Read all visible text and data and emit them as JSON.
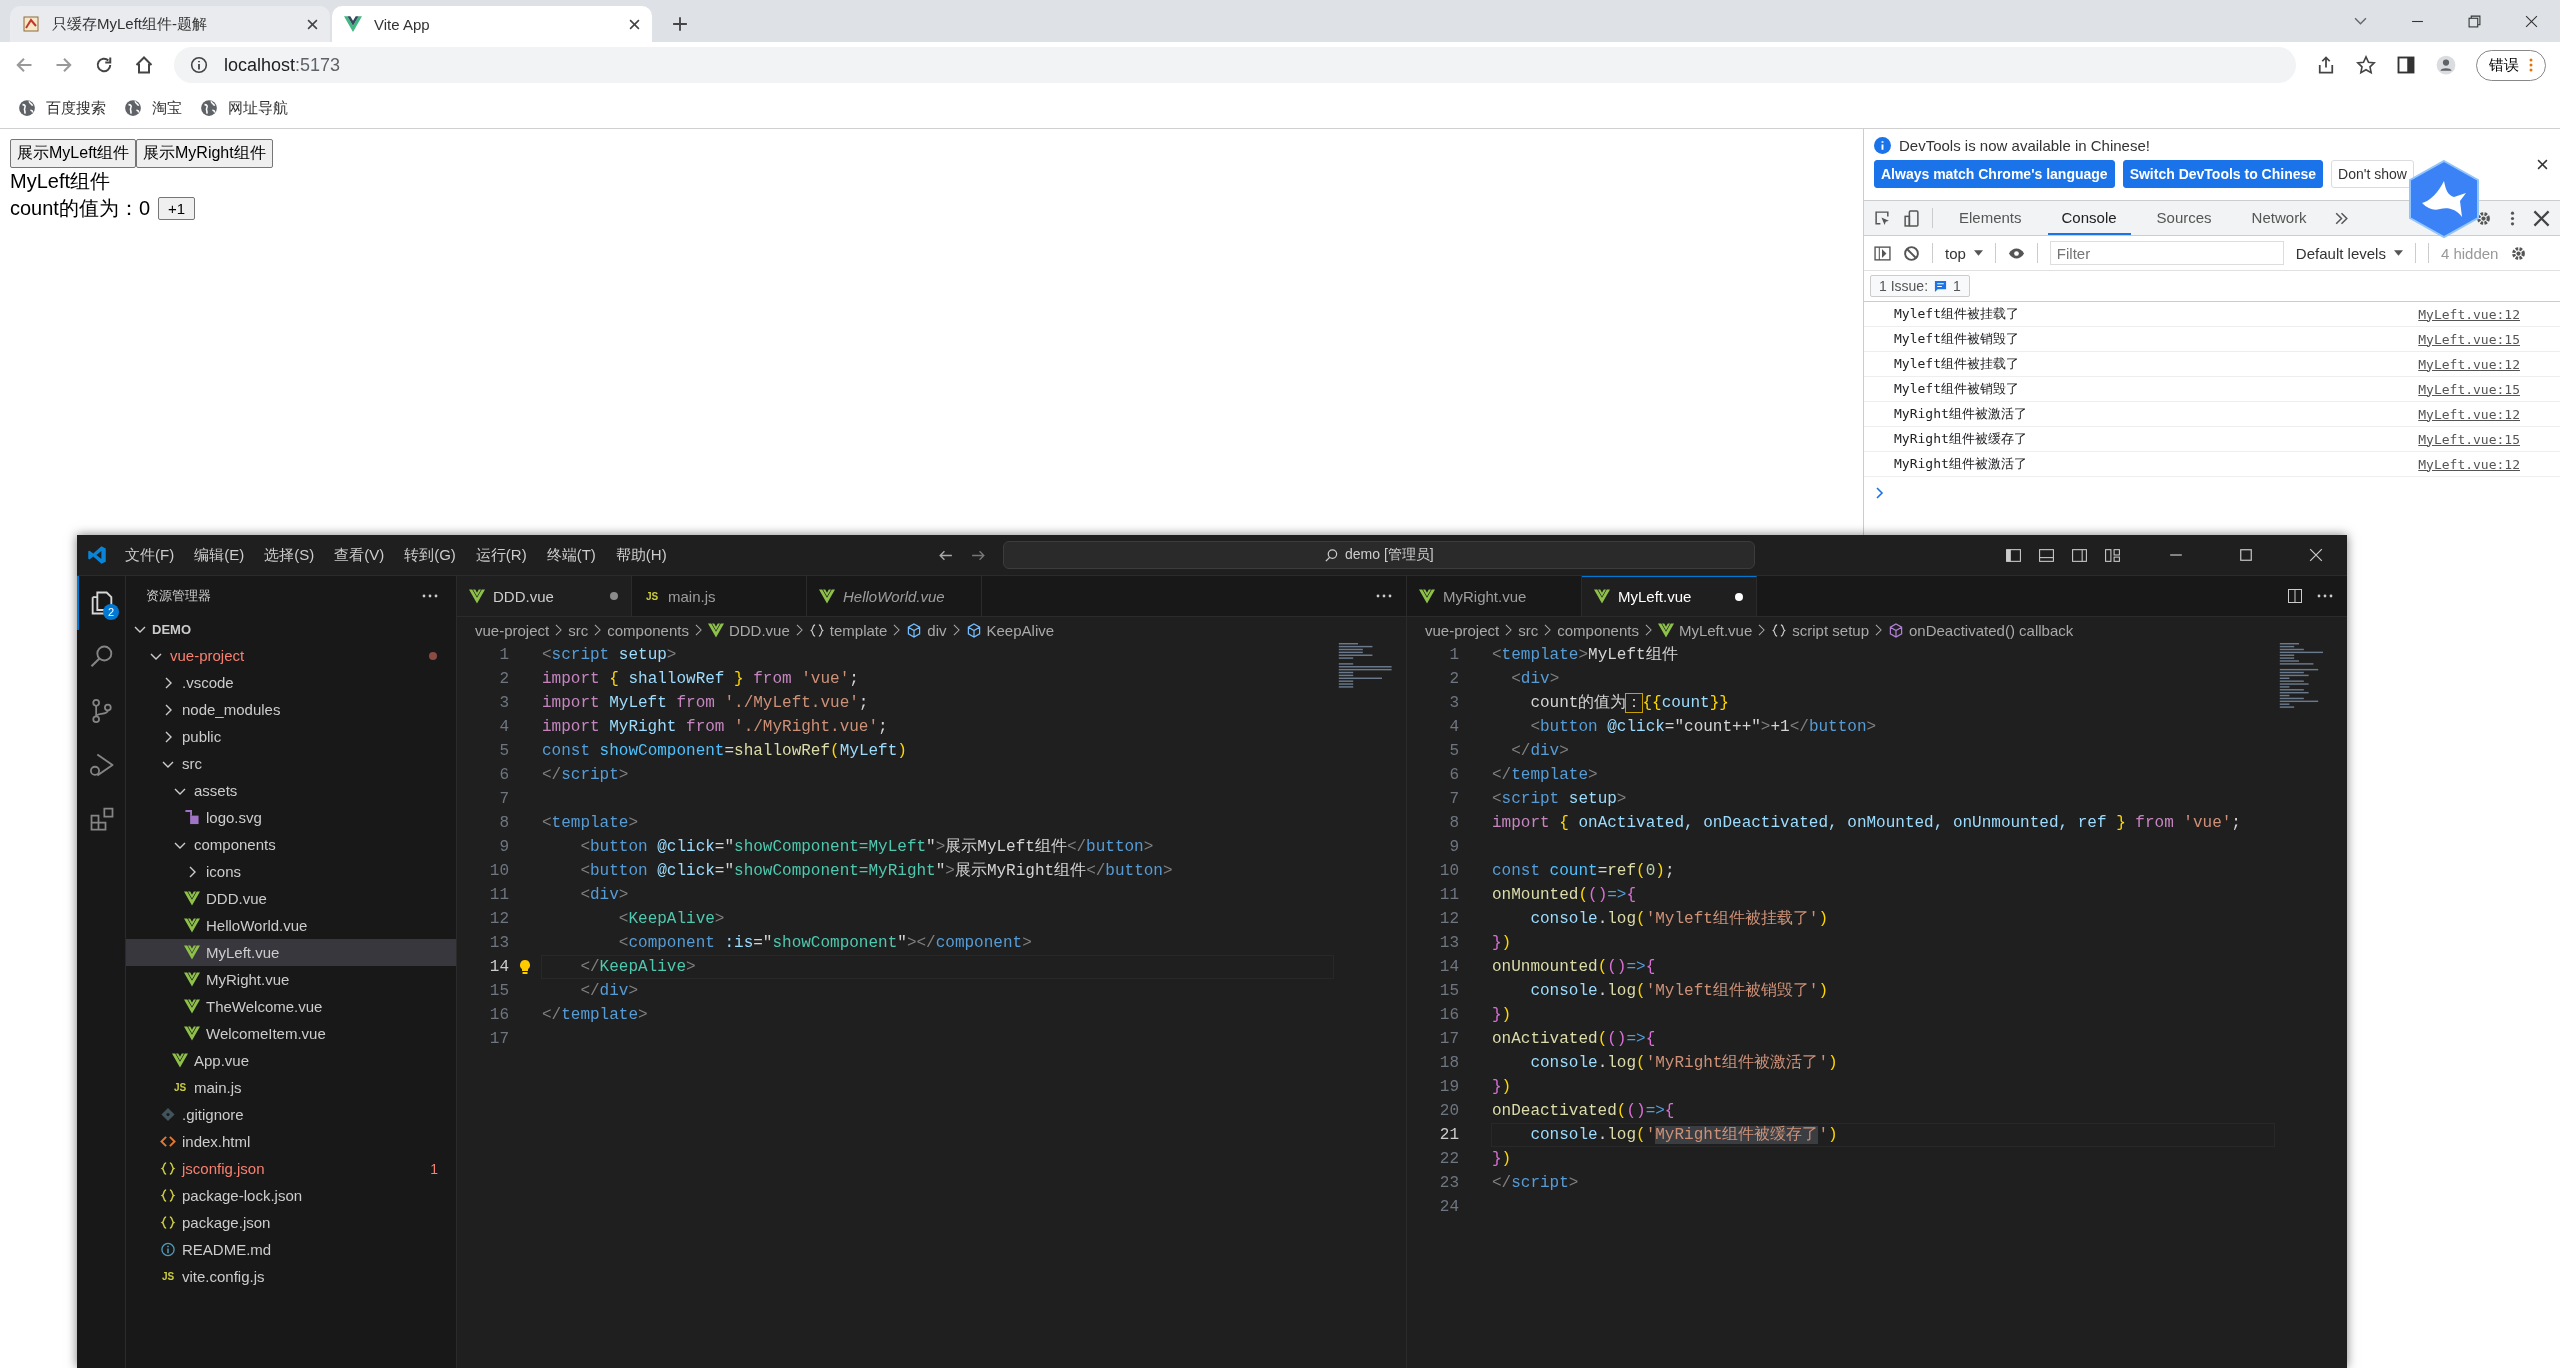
{
  "browser": {
    "tabs": [
      {
        "title": "只缓存MyLeft组件-题解",
        "kind": "favicon",
        "selected": false
      },
      {
        "title": "Vite App",
        "kind": "vue",
        "selected": true
      }
    ],
    "url": {
      "host": "localhost",
      "port": ":5173"
    },
    "profile_button": "错误",
    "bookmarks": [
      "百度搜索",
      "淘宝",
      "网址导航"
    ]
  },
  "page": {
    "buttons": [
      "展示MyLeft组件",
      "展示MyRight组件"
    ],
    "heading": "MyLeft组件",
    "count_text": "count的值为：0",
    "increment_button": "+1"
  },
  "devtools": {
    "banner": {
      "message": "DevTools is now available in Chinese!",
      "buttons": [
        {
          "label": "Always match Chrome's language",
          "kind": "primary"
        },
        {
          "label": "Switch DevTools to Chinese",
          "kind": "primary"
        },
        {
          "label": "Don't show",
          "kind": "secondary"
        }
      ]
    },
    "tabs": [
      {
        "label": "Elements",
        "selected": false
      },
      {
        "label": "Console",
        "selected": true
      },
      {
        "label": "Sources",
        "selected": false
      },
      {
        "label": "Network",
        "selected": false
      }
    ],
    "context": "top",
    "filter_placeholder": "Filter",
    "levels": "Default levels",
    "hidden": "4 hidden",
    "issues": {
      "label": "1 Issue:",
      "count": "1"
    },
    "messages": [
      {
        "text": "Myleft组件被挂载了",
        "source": "MyLeft.vue:12"
      },
      {
        "text": "Myleft组件被销毁了",
        "source": "MyLeft.vue:15"
      },
      {
        "text": "Myleft组件被挂载了",
        "source": "MyLeft.vue:12"
      },
      {
        "text": "Myleft组件被销毁了",
        "source": "MyLeft.vue:15"
      },
      {
        "text": "MyRight组件被激活了",
        "source": "MyLeft.vue:12"
      },
      {
        "text": "MyRight组件被缓存了",
        "source": "MyLeft.vue:15"
      },
      {
        "text": "MyRight组件被激活了",
        "source": "MyLeft.vue:12"
      }
    ]
  },
  "vscode": {
    "menu": [
      "文件(F)",
      "编辑(E)",
      "选择(S)",
      "查看(V)",
      "转到(G)",
      "运行(R)",
      "终端(T)",
      "帮助(H)"
    ],
    "search": "demo [管理员]",
    "activity": [
      {
        "kind": "files",
        "selected": true,
        "badge": "2"
      },
      {
        "kind": "search",
        "selected": false
      },
      {
        "kind": "source-control",
        "selected": false
      },
      {
        "kind": "run-debug",
        "selected": false
      },
      {
        "kind": "extensions",
        "selected": false
      }
    ],
    "explorer": {
      "title": "资源管理器",
      "section": "DEMO",
      "tree": [
        {
          "label": "vue-project",
          "kind": "folder",
          "expanded": true,
          "selected": false,
          "problem": true,
          "children": [
            {
              "label": ".vscode",
              "kind": "folder",
              "expanded": false,
              "selected": false,
              "problem": false
            },
            {
              "label": "node_modules",
              "kind": "folder",
              "expanded": false,
              "selected": false,
              "problem": false
            },
            {
              "label": "public",
              "kind": "folder",
              "expanded": false,
              "selected": false,
              "problem": false
            },
            {
              "label": "src",
              "kind": "folder",
              "expanded": true,
              "selected": false,
              "problem": false,
              "children": [
                {
                  "label": "assets",
                  "kind": "folder",
                  "expanded": true,
                  "selected": false,
                  "problem": false,
                  "children": [
                    {
                      "label": "logo.svg",
                      "kind": "svg",
                      "selected": false,
                      "problem": false
                    }
                  ]
                },
                {
                  "label": "components",
                  "kind": "folder",
                  "expanded": true,
                  "selected": false,
                  "problem": false,
                  "children": [
                    {
                      "label": "icons",
                      "kind": "folder",
                      "expanded": false,
                      "selected": false,
                      "problem": false
                    },
                    {
                      "label": "DDD.vue",
                      "kind": "vue",
                      "selected": false,
                      "problem": false
                    },
                    {
                      "label": "HelloWorld.vue",
                      "kind": "vue",
                      "selected": false,
                      "problem": false
                    },
                    {
                      "label": "MyLeft.vue",
                      "kind": "vue",
                      "selected": true,
                      "problem": false
                    },
                    {
                      "label": "MyRight.vue",
                      "kind": "vue",
                      "selected": false,
                      "problem": false
                    },
                    {
                      "label": "TheWelcome.vue",
                      "kind": "vue",
                      "selected": false,
                      "problem": false
                    },
                    {
                      "label": "WelcomeItem.vue",
                      "kind": "vue",
                      "selected": false,
                      "problem": false
                    }
                  ]
                },
                {
                  "label": "App.vue",
                  "kind": "vue",
                  "selected": false,
                  "problem": false
                },
                {
                  "label": "main.js",
                  "kind": "js",
                  "icon_text": "JS",
                  "selected": false,
                  "problem": false
                }
              ]
            },
            {
              "label": ".gitignore",
              "kind": "git",
              "selected": false,
              "problem": false
            },
            {
              "label": "index.html",
              "kind": "html",
              "selected": false,
              "problem": false
            },
            {
              "label": "jsconfig.json",
              "kind": "json",
              "selected": false,
              "problem": true,
              "badge": "1"
            },
            {
              "label": "package-lock.json",
              "kind": "json",
              "selected": false,
              "problem": false
            },
            {
              "label": "package.json",
              "kind": "json",
              "selected": false,
              "problem": false
            },
            {
              "label": "README.md",
              "kind": "info",
              "selected": false,
              "problem": false
            },
            {
              "label": "vite.config.js",
              "kind": "js",
              "icon_text": "JS",
              "selected": false,
              "problem": false
            }
          ]
        }
      ]
    },
    "editors": [
      {
        "focused": false,
        "lightbulb": true,
        "tabs": [
          {
            "label": "DDD.vue",
            "kind": "vue",
            "selected": true,
            "modified": true,
            "preview": false
          },
          {
            "label": "main.js",
            "kind": "js",
            "icon_text": "JS",
            "selected": false,
            "modified": false,
            "preview": false
          },
          {
            "label": "HelloWorld.vue",
            "kind": "vue",
            "selected": false,
            "modified": false,
            "preview": true
          }
        ],
        "breadcrumbs": [
          {
            "label": "vue-project"
          },
          {
            "label": "src"
          },
          {
            "label": "components"
          },
          {
            "label": "DDD.vue",
            "kind": "vue"
          },
          {
            "label": "template",
            "kind": "braces"
          },
          {
            "label": "div",
            "kind": "cube"
          },
          {
            "label": "KeepAlive",
            "kind": "cube"
          }
        ],
        "lines": [
          {
            "n": "1",
            "current": false,
            "tokens": [
              {
                "text": "<",
                "kind": "punct"
              },
              {
                "text": "script",
                "kind": "tag"
              },
              {
                "text": " setup",
                "kind": "attr"
              },
              {
                "text": ">",
                "kind": "punct"
              }
            ]
          },
          {
            "n": "2",
            "current": false,
            "tokens": [
              {
                "text": "import ",
                "kind": "kw"
              },
              {
                "text": "{",
                "kind": "brace"
              },
              {
                "text": " shallowRef ",
                "kind": "var"
              },
              {
                "text": "}",
                "kind": "brace"
              },
              {
                "text": " from ",
                "kind": "kw"
              },
              {
                "text": "'vue'",
                "kind": "str"
              },
              {
                "text": ";",
                "kind": "plain"
              }
            ]
          },
          {
            "n": "3",
            "current": false,
            "tokens": [
              {
                "text": "import",
                "kind": "kw"
              },
              {
                "text": " MyLeft ",
                "kind": "var"
              },
              {
                "text": "from ",
                "kind": "kw"
              },
              {
                "text": "'./MyLeft.vue'",
                "kind": "str"
              },
              {
                "text": ";",
                "kind": "plain"
              }
            ]
          },
          {
            "n": "4",
            "current": false,
            "tokens": [
              {
                "text": "import",
                "kind": "kw"
              },
              {
                "text": " MyRight ",
                "kind": "var"
              },
              {
                "text": "from ",
                "kind": "kw"
              },
              {
                "text": "'./MyRight.vue'",
                "kind": "str"
              },
              {
                "text": ";",
                "kind": "plain"
              }
            ]
          },
          {
            "n": "5",
            "current": false,
            "tokens": [
              {
                "text": "const",
                "kind": "decl"
              },
              {
                "text": " showComponent",
                "kind": "const"
              },
              {
                "text": "=",
                "kind": "plain"
              },
              {
                "text": "shallowRef",
                "kind": "fn"
              },
              {
                "text": "(",
                "kind": "brace"
              },
              {
                "text": "MyLeft",
                "kind": "var"
              },
              {
                "text": ")",
                "kind": "brace"
              }
            ]
          },
          {
            "n": "6",
            "current": false,
            "tokens": [
              {
                "text": "</",
                "kind": "punct"
              },
              {
                "text": "script",
                "kind": "tag"
              },
              {
                "text": ">",
                "kind": "punct"
              }
            ]
          },
          {
            "n": "7",
            "current": false
          },
          {
            "n": "8",
            "current": false,
            "tokens": [
              {
                "text": "<",
                "kind": "punct"
              },
              {
                "text": "template",
                "kind": "tag"
              },
              {
                "text": ">",
                "kind": "punct"
              }
            ]
          },
          {
            "n": "9",
            "current": false,
            "tokens": [
              {
                "text": "    <",
                "kind": "punct"
              },
              {
                "text": "button",
                "kind": "tag"
              },
              {
                "text": " @click",
                "kind": "attr"
              },
              {
                "text": "=\"",
                "kind": "plain"
              },
              {
                "text": "showComponent=MyLeft",
                "kind": "jsin"
              },
              {
                "text": "\"",
                "kind": "plain"
              },
              {
                "text": ">",
                "kind": "punct"
              },
              {
                "text": "展示MyLeft组件",
                "kind": "plain"
              },
              {
                "text": "</",
                "kind": "punct"
              },
              {
                "text": "button",
                "kind": "tag"
              },
              {
                "text": ">",
                "kind": "punct"
              }
            ]
          },
          {
            "n": "10",
            "current": false,
            "tokens": [
              {
                "text": "    <",
                "kind": "punct"
              },
              {
                "text": "button",
                "kind": "tag"
              },
              {
                "text": " @click",
                "kind": "attr"
              },
              {
                "text": "=\"",
                "kind": "plain"
              },
              {
                "text": "showComponent=MyRight",
                "kind": "jsin"
              },
              {
                "text": "\"",
                "kind": "plain"
              },
              {
                "text": ">",
                "kind": "punct"
              },
              {
                "text": "展示MyRight组件",
                "kind": "plain"
              },
              {
                "text": "</",
                "kind": "punct"
              },
              {
                "text": "button",
                "kind": "tag"
              },
              {
                "text": ">",
                "kind": "punct"
              }
            ]
          },
          {
            "n": "11",
            "current": false,
            "tokens": [
              {
                "text": "    <",
                "kind": "punct"
              },
              {
                "text": "div",
                "kind": "tag"
              },
              {
                "text": ">",
                "kind": "punct"
              }
            ]
          },
          {
            "n": "12",
            "current": false,
            "tokens": [
              {
                "text": "        <",
                "kind": "punct"
              },
              {
                "text": "KeepAlive",
                "kind": "comp"
              },
              {
                "text": ">",
                "kind": "punct"
              }
            ]
          },
          {
            "n": "13",
            "current": false,
            "tokens": [
              {
                "text": "        <",
                "kind": "punct"
              },
              {
                "text": "component",
                "kind": "tag"
              },
              {
                "text": " :is",
                "kind": "attr"
              },
              {
                "text": "=\"",
                "kind": "plain"
              },
              {
                "text": "showComponent",
                "kind": "jsin"
              },
              {
                "text": "\"",
                "kind": "plain"
              },
              {
                "text": "></",
                "kind": "punct"
              },
              {
                "text": "component",
                "kind": "tag"
              },
              {
                "text": ">",
                "kind": "punct"
              }
            ]
          },
          {
            "n": "14",
            "current": true,
            "tokens": [
              {
                "text": "    </",
                "kind": "punct"
              },
              {
                "text": "KeepAlive",
                "kind": "comp"
              },
              {
                "text": ">",
                "kind": "punct"
              }
            ]
          },
          {
            "n": "15",
            "current": false,
            "tokens": [
              {
                "text": "    </",
                "kind": "punct"
              },
              {
                "text": "div",
                "kind": "tag"
              },
              {
                "text": ">",
                "kind": "punct"
              }
            ]
          },
          {
            "n": "16",
            "current": false,
            "tokens": [
              {
                "text": "</",
                "kind": "punct"
              },
              {
                "text": "template",
                "kind": "tag"
              },
              {
                "text": ">",
                "kind": "punct"
              }
            ]
          },
          {
            "n": "17",
            "current": false
          }
        ]
      },
      {
        "focused": true,
        "lightbulb": false,
        "tabs": [
          {
            "label": "MyRight.vue",
            "kind": "vue",
            "selected": false,
            "modified": false,
            "preview": false
          },
          {
            "label": "MyLeft.vue",
            "kind": "vue",
            "selected": true,
            "modified": true,
            "preview": false
          }
        ],
        "breadcrumbs": [
          {
            "label": "vue-project"
          },
          {
            "label": "src"
          },
          {
            "label": "components"
          },
          {
            "label": "MyLeft.vue",
            "kind": "vue"
          },
          {
            "label": "script setup",
            "kind": "braces"
          },
          {
            "label": "onDeactivated() callback",
            "kind": "method"
          }
        ],
        "lines": [
          {
            "n": "1",
            "current": false,
            "tokens": [
              {
                "text": "<",
                "kind": "punct"
              },
              {
                "text": "template",
                "kind": "tag"
              },
              {
                "text": ">",
                "kind": "punct"
              },
              {
                "text": "MyLeft组件",
                "kind": "plain"
              }
            ]
          },
          {
            "n": "2",
            "current": false,
            "tokens": [
              {
                "text": "  <",
                "kind": "punct"
              },
              {
                "text": "div",
                "kind": "tag"
              },
              {
                "text": ">",
                "kind": "punct"
              }
            ]
          },
          {
            "n": "3",
            "current": false,
            "tokens": [
              {
                "text": "    count的值为",
                "kind": "plain"
              },
              {
                "text": "：",
                "kind": "box"
              },
              {
                "text": "{{",
                "kind": "brace"
              },
              {
                "text": "count",
                "kind": "var"
              },
              {
                "text": "}}",
                "kind": "brace"
              }
            ]
          },
          {
            "n": "4",
            "current": false,
            "tokens": [
              {
                "text": "    <",
                "kind": "punct"
              },
              {
                "text": "button",
                "kind": "tag"
              },
              {
                "text": " @click",
                "kind": "attr"
              },
              {
                "text": "=\"count++\"",
                "kind": "plain"
              },
              {
                "text": ">",
                "kind": "punct"
              },
              {
                "text": "+1",
                "kind": "plain"
              },
              {
                "text": "</",
                "kind": "punct"
              },
              {
                "text": "button",
                "kind": "tag"
              },
              {
                "text": ">",
                "kind": "punct"
              }
            ]
          },
          {
            "n": "5",
            "current": false,
            "tokens": [
              {
                "text": "  </",
                "kind": "punct"
              },
              {
                "text": "div",
                "kind": "tag"
              },
              {
                "text": ">",
                "kind": "punct"
              }
            ]
          },
          {
            "n": "6",
            "current": false,
            "tokens": [
              {
                "text": "</",
                "kind": "punct"
              },
              {
                "text": "template",
                "kind": "tag"
              },
              {
                "text": ">",
                "kind": "punct"
              }
            ]
          },
          {
            "n": "7",
            "current": false,
            "tokens": [
              {
                "text": "<",
                "kind": "punct"
              },
              {
                "text": "script",
                "kind": "tag"
              },
              {
                "text": " setup",
                "kind": "attr"
              },
              {
                "text": ">",
                "kind": "punct"
              }
            ]
          },
          {
            "n": "8",
            "current": false,
            "tokens": [
              {
                "text": "import ",
                "kind": "kw"
              },
              {
                "text": "{",
                "kind": "brace"
              },
              {
                "text": " onActivated, onDeactivated, onMounted, onUnmounted, ref ",
                "kind": "var"
              },
              {
                "text": "}",
                "kind": "brace"
              },
              {
                "text": " from ",
                "kind": "kw"
              },
              {
                "text": "'vue'",
                "kind": "str"
              },
              {
                "text": ";",
                "kind": "plain"
              }
            ]
          },
          {
            "n": "9",
            "current": false
          },
          {
            "n": "10",
            "current": false,
            "tokens": [
              {
                "text": "const",
                "kind": "decl"
              },
              {
                "text": " count",
                "kind": "const"
              },
              {
                "text": "=",
                "kind": "plain"
              },
              {
                "text": "ref",
                "kind": "fn"
              },
              {
                "text": "(",
                "kind": "brace"
              },
              {
                "text": "0",
                "kind": "num"
              },
              {
                "text": ")",
                "kind": "brace"
              },
              {
                "text": ";",
                "kind": "plain"
              }
            ]
          },
          {
            "n": "11",
            "current": false,
            "tokens": [
              {
                "text": "onMounted",
                "kind": "fn"
              },
              {
                "text": "(",
                "kind": "brace"
              },
              {
                "text": "()",
                "kind": "brace2"
              },
              {
                "text": "=>",
                "kind": "decl"
              },
              {
                "text": "{",
                "kind": "brace2"
              }
            ]
          },
          {
            "n": "12",
            "current": false,
            "tokens": [
              {
                "text": "    console",
                "kind": "var"
              },
              {
                "text": ".",
                "kind": "plain"
              },
              {
                "text": "log",
                "kind": "fn"
              },
              {
                "text": "(",
                "kind": "brace"
              },
              {
                "text": "'Myleft组件被挂载了'",
                "kind": "str"
              },
              {
                "text": ")",
                "kind": "brace"
              }
            ]
          },
          {
            "n": "13",
            "current": false,
            "tokens": [
              {
                "text": "}",
                "kind": "brace2"
              },
              {
                "text": ")",
                "kind": "brace"
              }
            ]
          },
          {
            "n": "14",
            "current": false,
            "tokens": [
              {
                "text": "onUnmounted",
                "kind": "fn"
              },
              {
                "text": "(",
                "kind": "brace"
              },
              {
                "text": "()",
                "kind": "brace2"
              },
              {
                "text": "=>",
                "kind": "decl"
              },
              {
                "text": "{",
                "kind": "brace2"
              }
            ]
          },
          {
            "n": "15",
            "current": false,
            "tokens": [
              {
                "text": "    console",
                "kind": "var"
              },
              {
                "text": ".",
                "kind": "plain"
              },
              {
                "text": "log",
                "kind": "fn"
              },
              {
                "text": "(",
                "kind": "brace"
              },
              {
                "text": "'Myleft组件被销毁了'",
                "kind": "str"
              },
              {
                "text": ")",
                "kind": "brace"
              }
            ]
          },
          {
            "n": "16",
            "current": false,
            "tokens": [
              {
                "text": "}",
                "kind": "brace2"
              },
              {
                "text": ")",
                "kind": "brace"
              }
            ]
          },
          {
            "n": "17",
            "current": false,
            "tokens": [
              {
                "text": "onActivated",
                "kind": "fn"
              },
              {
                "text": "(",
                "kind": "brace"
              },
              {
                "text": "()",
                "kind": "brace2"
              },
              {
                "text": "=>",
                "kind": "decl"
              },
              {
                "text": "{",
                "kind": "brace2"
              }
            ]
          },
          {
            "n": "18",
            "current": false,
            "tokens": [
              {
                "text": "    console",
                "kind": "var"
              },
              {
                "text": ".",
                "kind": "plain"
              },
              {
                "text": "log",
                "kind": "fn"
              },
              {
                "text": "(",
                "kind": "brace"
              },
              {
                "text": "'MyRight组件被激活了'",
                "kind": "str"
              },
              {
                "text": ")",
                "kind": "brace"
              }
            ]
          },
          {
            "n": "19",
            "current": false,
            "tokens": [
              {
                "text": "}",
                "kind": "brace2"
              },
              {
                "text": ")",
                "kind": "brace"
              }
            ]
          },
          {
            "n": "20",
            "current": false,
            "tokens": [
              {
                "text": "onDeactivated",
                "kind": "fn"
              },
              {
                "text": "(",
                "kind": "brace"
              },
              {
                "text": "()",
                "kind": "brace2"
              },
              {
                "text": "=>",
                "kind": "decl"
              },
              {
                "text": "{",
                "kind": "brace2"
              }
            ]
          },
          {
            "n": "21",
            "current": true,
            "tokens": [
              {
                "text": "    console",
                "kind": "var"
              },
              {
                "text": ".",
                "kind": "plain"
              },
              {
                "text": "log",
                "kind": "fn"
              },
              {
                "text": "(",
                "kind": "brace"
              },
              {
                "text": "'",
                "kind": "str"
              },
              {
                "text": "MyRight组件被缓存了",
                "kind": "strsel"
              },
              {
                "text": "'",
                "kind": "str"
              },
              {
                "text": ")",
                "kind": "brace"
              }
            ]
          },
          {
            "n": "22",
            "current": false,
            "tokens": [
              {
                "text": "}",
                "kind": "brace2"
              },
              {
                "text": ")",
                "kind": "brace"
              }
            ]
          },
          {
            "n": "23",
            "current": false,
            "tokens": [
              {
                "text": "</",
                "kind": "punct"
              },
              {
                "text": "script",
                "kind": "tag"
              },
              {
                "text": ">",
                "kind": "punct"
              }
            ]
          },
          {
            "n": "24",
            "current": false
          }
        ]
      }
    ]
  }
}
